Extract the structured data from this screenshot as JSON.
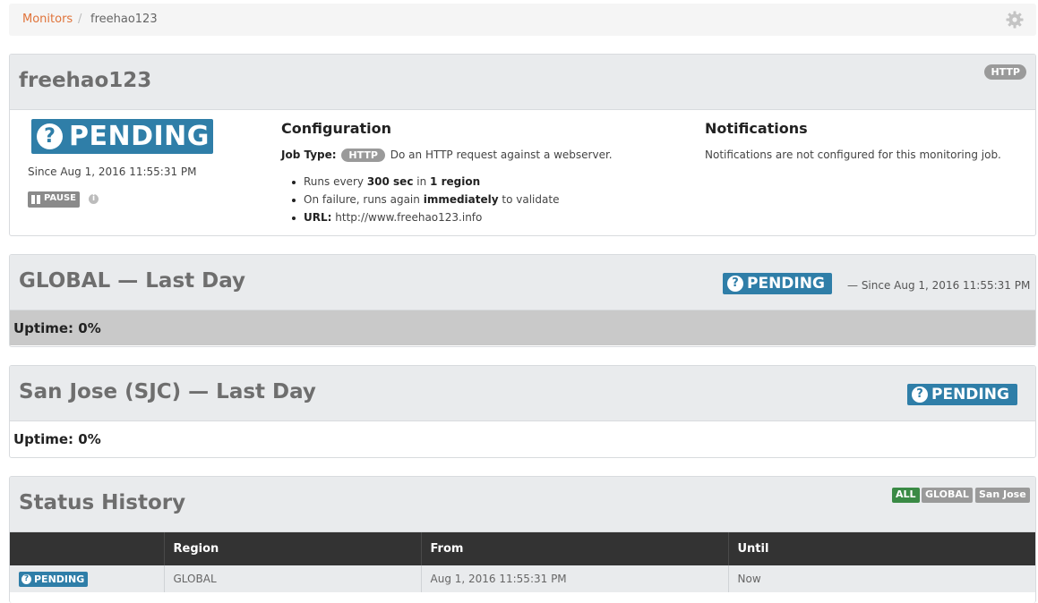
{
  "breadcrumb": {
    "root": "Monitors",
    "separator": "/",
    "current": "freehao123"
  },
  "monitor": {
    "name": "freehao123",
    "type_badge": "HTTP",
    "status": "PENDING",
    "since": "Since Aug 1, 2016 11:55:31 PM",
    "pause_label": "PAUSE",
    "info_icon": "i"
  },
  "configuration": {
    "heading": "Configuration",
    "job_type_label": "Job Type:",
    "job_type_badge": "HTTP",
    "job_type_desc": "Do an HTTP request against a webserver.",
    "runs_prefix": "Runs every",
    "runs_interval": "300 sec",
    "runs_mid": "in",
    "runs_regions": "1 region",
    "failure_prefix": "On failure, runs again",
    "failure_bold": "immediately",
    "failure_suffix": "to validate",
    "url_label": "URL:",
    "url_value": "http://www.freehao123.info"
  },
  "notifications": {
    "heading": "Notifications",
    "text": "Notifications are not configured for this monitoring job."
  },
  "global_panel": {
    "title": "GLOBAL — Last Day",
    "status": "PENDING",
    "since": "— Since Aug 1, 2016 11:55:31 PM",
    "uptime": "Uptime: 0%"
  },
  "sjc_panel": {
    "title": "San Jose (SJC) — Last Day",
    "status": "PENDING",
    "uptime": "Uptime: 0%"
  },
  "history": {
    "title": "Status History",
    "filters": [
      "ALL",
      "GLOBAL",
      "San Jose"
    ],
    "columns": [
      "",
      "Region",
      "From",
      "Until"
    ],
    "rows": [
      {
        "status": "PENDING",
        "region": "GLOBAL",
        "from": "Aug 1, 2016 11:55:31 PM",
        "until": "Now"
      }
    ]
  },
  "colors": {
    "accent": "#e0733a",
    "pending": "#2f7ea8",
    "all_filter": "#3a8a45",
    "gray_badge": "#9a9a9a",
    "table_header": "#333333"
  }
}
